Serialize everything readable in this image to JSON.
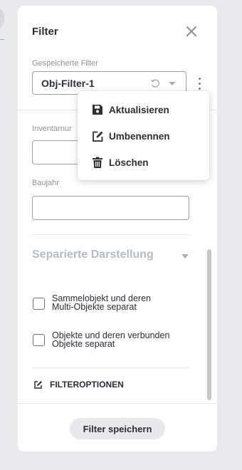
{
  "panel": {
    "title": "Filter",
    "saved_filters_label": "Gespeicherte Filter",
    "selected_filter": "Obj-Filter-1"
  },
  "menu": {
    "items": [
      {
        "label": "Aktualisieren",
        "icon": "save-icon"
      },
      {
        "label": "Umbenennen",
        "icon": "edit-icon"
      },
      {
        "label": "Löschen",
        "icon": "trash-icon"
      }
    ]
  },
  "fields": {
    "inventory_label": "Inventarnur",
    "inventory_value": "",
    "year_label": "Baujahr",
    "year_value": ""
  },
  "section": {
    "title": "Separierte Darstellung",
    "options": [
      {
        "line1": "Sammelobjekt und deren",
        "line2": "Multi-Objekte separat",
        "checked": false
      },
      {
        "line1": "Objekte und deren verbunden",
        "line2": "Objekte separat",
        "checked": false
      }
    ]
  },
  "filteroptions_label": "FILTEROPTIONEN",
  "save_button_label": "Filter speichern",
  "colors": {
    "background": "#e9eaee",
    "panel": "#ffffff",
    "text": "#2b2f36",
    "muted": "#8e939c",
    "button_bg": "#e8e9ec"
  }
}
